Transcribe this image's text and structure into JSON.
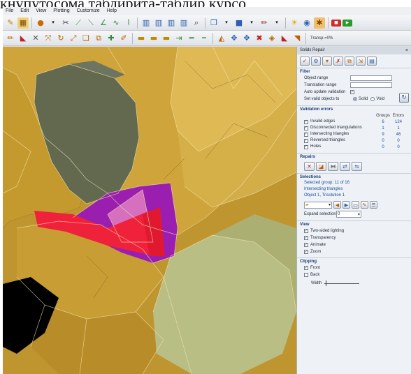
{
  "caption": "кнупутосома таблирита-таблир курсо",
  "menu": [
    "File",
    "Edit",
    "View",
    "Plotting",
    "Customize",
    "Help"
  ],
  "toolbar": {
    "transparency_label": "Transp.=0%"
  },
  "colors": {
    "mesh_gold": "#d3a93c",
    "mesh_dark": "#5d6650",
    "mesh_light_green": "#b8c08a",
    "error_red": "#f0213a",
    "error_purple": "#9a1fb0",
    "error_pink": "#d66fbe",
    "panel_bg": "#eef1f5",
    "link_blue": "#1d4fa0"
  },
  "panel": {
    "title": "Solids Repair",
    "close_glyph": "×",
    "filter": {
      "heading": "Filter",
      "object_range_label": "Object range",
      "object_range_value": "",
      "translation_range_label": "Translation range",
      "translation_range_value": "",
      "auto_update_label": "Auto update validation",
      "auto_update_checked": true,
      "set_valid_label": "Set valid objects to",
      "option_solid": "Solid",
      "option_void": "Void",
      "selected_option": "Solid"
    },
    "validation": {
      "heading": "Validation errors",
      "col_groups": "Groups",
      "col_errors": "Errors",
      "rows": [
        {
          "label": "Invalid edges",
          "checked": true,
          "groups": "6",
          "errors": "124"
        },
        {
          "label": "Disconnected triangulations",
          "checked": true,
          "groups": "1",
          "errors": "1"
        },
        {
          "label": "Intersecting triangles",
          "checked": true,
          "groups": "9",
          "errors": "46"
        },
        {
          "label": "Reversed triangles",
          "checked": true,
          "groups": "0",
          "errors": "0"
        },
        {
          "label": "Holes",
          "checked": true,
          "groups": "0",
          "errors": "0"
        }
      ]
    },
    "repairs": {
      "heading": "Repairs"
    },
    "selections": {
      "heading": "Selections",
      "selected_group": "Selected group: 11 of 16",
      "group_type": "Intersecting triangles",
      "object_ref": "Object 1, Trisolution 1",
      "expand_label": "Expand selection",
      "expand_value": "0"
    },
    "view": {
      "heading": "View",
      "options": [
        {
          "label": "Two-sided lighting",
          "checked": true
        },
        {
          "label": "Transparency",
          "checked": true
        },
        {
          "label": "Animate",
          "checked": true
        },
        {
          "label": "Zoom",
          "checked": true
        }
      ]
    },
    "clipping": {
      "heading": "Clipping",
      "options": [
        {
          "label": "Front",
          "checked": true
        },
        {
          "label": "Back",
          "checked": false
        }
      ],
      "width_label": "Width"
    }
  }
}
